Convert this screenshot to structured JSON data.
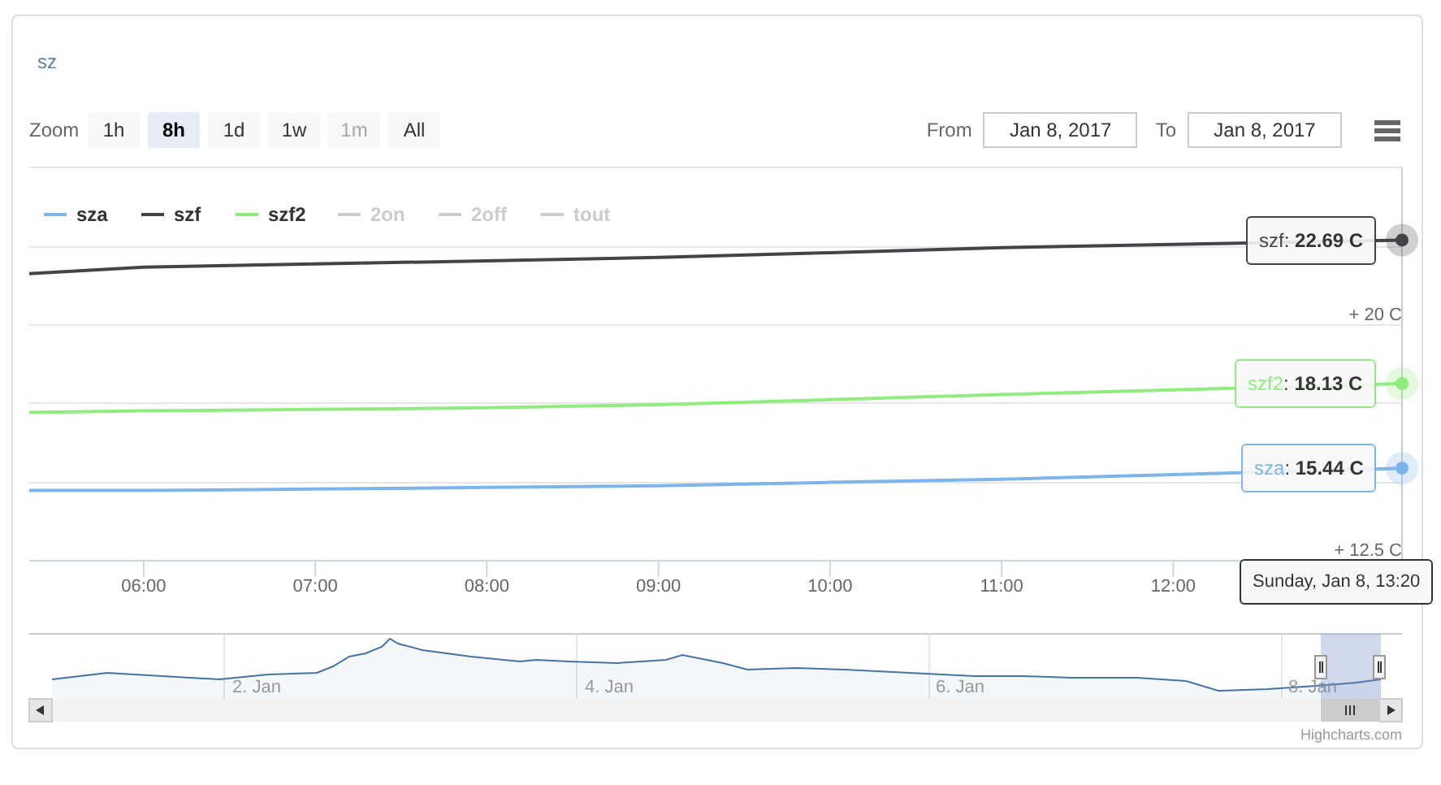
{
  "title": "sz",
  "range_selector": {
    "label": "Zoom",
    "buttons": [
      {
        "label": "1h",
        "selected": false,
        "disabled": false
      },
      {
        "label": "8h",
        "selected": true,
        "disabled": false
      },
      {
        "label": "1d",
        "selected": false,
        "disabled": false
      },
      {
        "label": "1w",
        "selected": false,
        "disabled": false
      },
      {
        "label": "1m",
        "selected": false,
        "disabled": true
      },
      {
        "label": "All",
        "selected": false,
        "disabled": false
      }
    ]
  },
  "date_range": {
    "from_label": "From",
    "from": "Jan 8, 2017",
    "to_label": "To",
    "to": "Jan 8, 2017"
  },
  "chart_data": {
    "type": "line",
    "legend": "top",
    "x": [
      5.333,
      6,
      7,
      8,
      9,
      10,
      11,
      12,
      13.333
    ],
    "xlim": [
      5.333,
      13.333
    ],
    "ylim": [
      12.5,
      25
    ],
    "xticks": [
      {
        "value": 6,
        "label": "06:00"
      },
      {
        "value": 7,
        "label": "07:00"
      },
      {
        "value": 8,
        "label": "08:00"
      },
      {
        "value": 9,
        "label": "09:00"
      },
      {
        "value": 10,
        "label": "10:00"
      },
      {
        "value": 11,
        "label": "11:00"
      },
      {
        "value": 12,
        "label": "12:00"
      }
    ],
    "yticks": [
      {
        "value": 20,
        "label": "+ 20 C"
      },
      {
        "value": 12.5,
        "label": "+ 12.5 C"
      }
    ],
    "series": [
      {
        "name": "sza",
        "color": "#7cb5ec",
        "values": [
          14.73,
          14.73,
          14.78,
          14.83,
          14.88,
          14.99,
          15.09,
          15.24,
          15.44
        ]
      },
      {
        "name": "szf",
        "color": "#434348",
        "values": [
          21.62,
          21.83,
          21.93,
          22.03,
          22.14,
          22.29,
          22.45,
          22.55,
          22.69
        ]
      },
      {
        "name": "szf2",
        "color": "#90ed7d",
        "values": [
          17.21,
          17.26,
          17.31,
          17.36,
          17.46,
          17.62,
          17.78,
          17.93,
          18.13
        ]
      }
    ]
  },
  "hidden_series_legend": [
    {
      "label": "2on",
      "visible": false
    },
    {
      "label": "2off",
      "visible": false
    },
    {
      "label": "tout",
      "visible": false
    }
  ],
  "tooltips": [
    {
      "name": "szf",
      "value": ": **22.69 C**",
      "color": "#434348"
    },
    {
      "name": "szf2",
      "value": ": **18.13 C**",
      "color": "#90ed7d"
    },
    {
      "name": "sza",
      "value": ": **15.44 C**",
      "color": "#7cb5ec"
    }
  ],
  "time_tooltip": "Sunday, Jan 8, 13:20",
  "navigator": {
    "labels": [
      "2. Jan",
      "4. Jan",
      "6. Jan",
      "8. Jan"
    ]
  },
  "credits": "Highcharts.com"
}
